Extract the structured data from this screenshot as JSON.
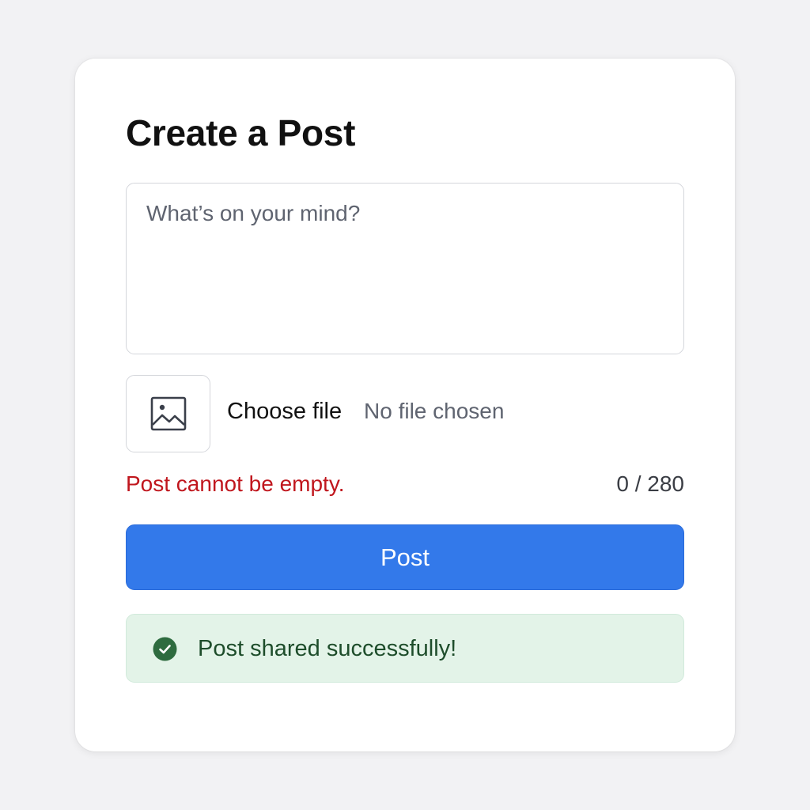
{
  "form": {
    "title": "Create a Post",
    "textarea_placeholder": "What’s on your mind?",
    "textarea_value": "",
    "image_icon": "image-icon",
    "choose_file_label": "Choose file",
    "file_status": "No file chosen",
    "error_message": "Post cannot be empty.",
    "char_counter": "0 / 280",
    "post_button_label": "Post",
    "success_message": "Post shared successfully!",
    "success_icon": "check-circle-icon"
  },
  "colors": {
    "accent": "#3379ea",
    "error": "#c0161d",
    "success_bg": "#e3f3e8",
    "success_text": "#1e4d2b",
    "success_icon": "#2e6b3f"
  }
}
